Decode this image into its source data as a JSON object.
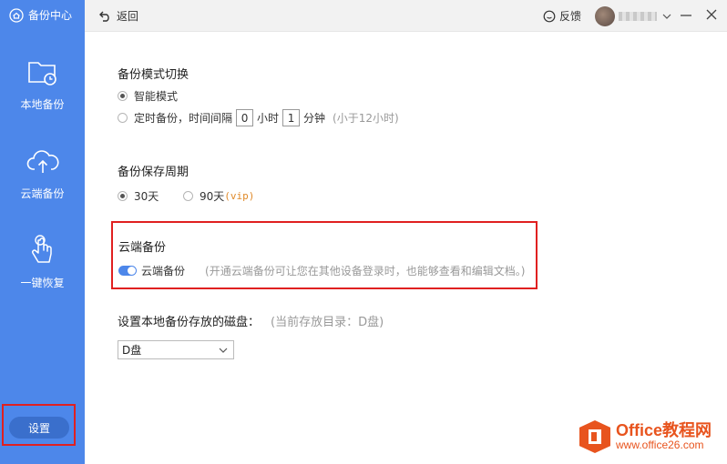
{
  "sidebar": {
    "title": "备份中心",
    "items": [
      {
        "label": "本地备份",
        "icon": "folder-clock-icon"
      },
      {
        "label": "云端备份",
        "icon": "cloud-upload-icon"
      },
      {
        "label": "一键恢复",
        "icon": "hand-tap-icon"
      }
    ],
    "settings_label": "设置"
  },
  "topbar": {
    "back_label": "返回",
    "feedback_label": "反馈"
  },
  "backup_mode": {
    "title": "备份模式切换",
    "smart_label": "智能模式",
    "scheduled_prefix": "定时备份，时间间隔",
    "hours_value": "0",
    "hours_unit": "小时",
    "minutes_value": "1",
    "minutes_unit": "分钟",
    "hint": "(小于12小时)"
  },
  "retention": {
    "title": "备份保存周期",
    "option1": "30天",
    "option2": "90天",
    "option2_suffix": "(vip)"
  },
  "cloud": {
    "title": "云端备份",
    "toggle_label": "云端备份",
    "toggle_on": true,
    "note": "(开通云端备份可让您在其他设备登录时，也能够查看和编辑文档。)"
  },
  "disk": {
    "label": "设置本地备份存放的磁盘：",
    "current_note": "(当前存放目录：D盘)",
    "selected": "D盘"
  },
  "watermark": {
    "title": "Office教程网",
    "url": "www.office26.com"
  },
  "colors": {
    "sidebar": "#4d87ea",
    "highlight": "#e02020",
    "brand_orange": "#e8541e"
  }
}
